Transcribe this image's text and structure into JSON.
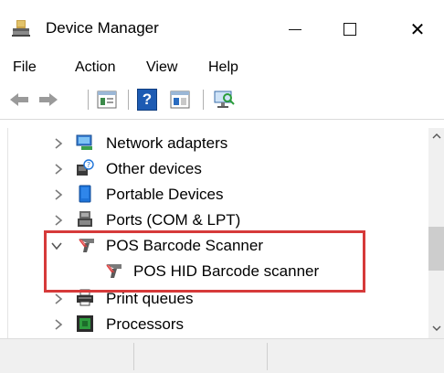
{
  "window": {
    "title": "Device Manager",
    "icons": {
      "app": "device-manager-icon",
      "minimize": "minimize-icon",
      "maximize": "maximize-icon",
      "close": "close-icon"
    },
    "close_glyph": "✕"
  },
  "menu": {
    "items": [
      "File",
      "Action",
      "View",
      "Help"
    ]
  },
  "toolbar": {
    "buttons": [
      "back-arrow-icon",
      "forward-arrow-icon",
      "properties-icon",
      "help-icon",
      "update-driver-icon",
      "scan-hardware-icon"
    ],
    "help_glyph": "?"
  },
  "tree": {
    "rows": [
      {
        "label": "Network adapters",
        "icon": "network-adapter-icon",
        "state": "collapsed"
      },
      {
        "label": "Other devices",
        "icon": "unknown-device-icon",
        "state": "collapsed"
      },
      {
        "label": "Portable Devices",
        "icon": "portable-device-icon",
        "state": "collapsed"
      },
      {
        "label": "Ports (COM & LPT)",
        "icon": "port-icon",
        "state": "collapsed"
      },
      {
        "label": "POS Barcode Scanner",
        "icon": "barcode-scanner-icon",
        "state": "expanded"
      },
      {
        "label": "POS HID Barcode scanner",
        "icon": "barcode-scanner-icon",
        "state": "child"
      },
      {
        "label": "Print queues",
        "icon": "printer-icon",
        "state": "collapsed"
      },
      {
        "label": "Processors",
        "icon": "processor-icon",
        "state": "collapsed"
      }
    ]
  },
  "colors": {
    "highlight": "#d63a3a",
    "folder_blue": "#1e73d8",
    "chevron": "#7a7a7a"
  }
}
